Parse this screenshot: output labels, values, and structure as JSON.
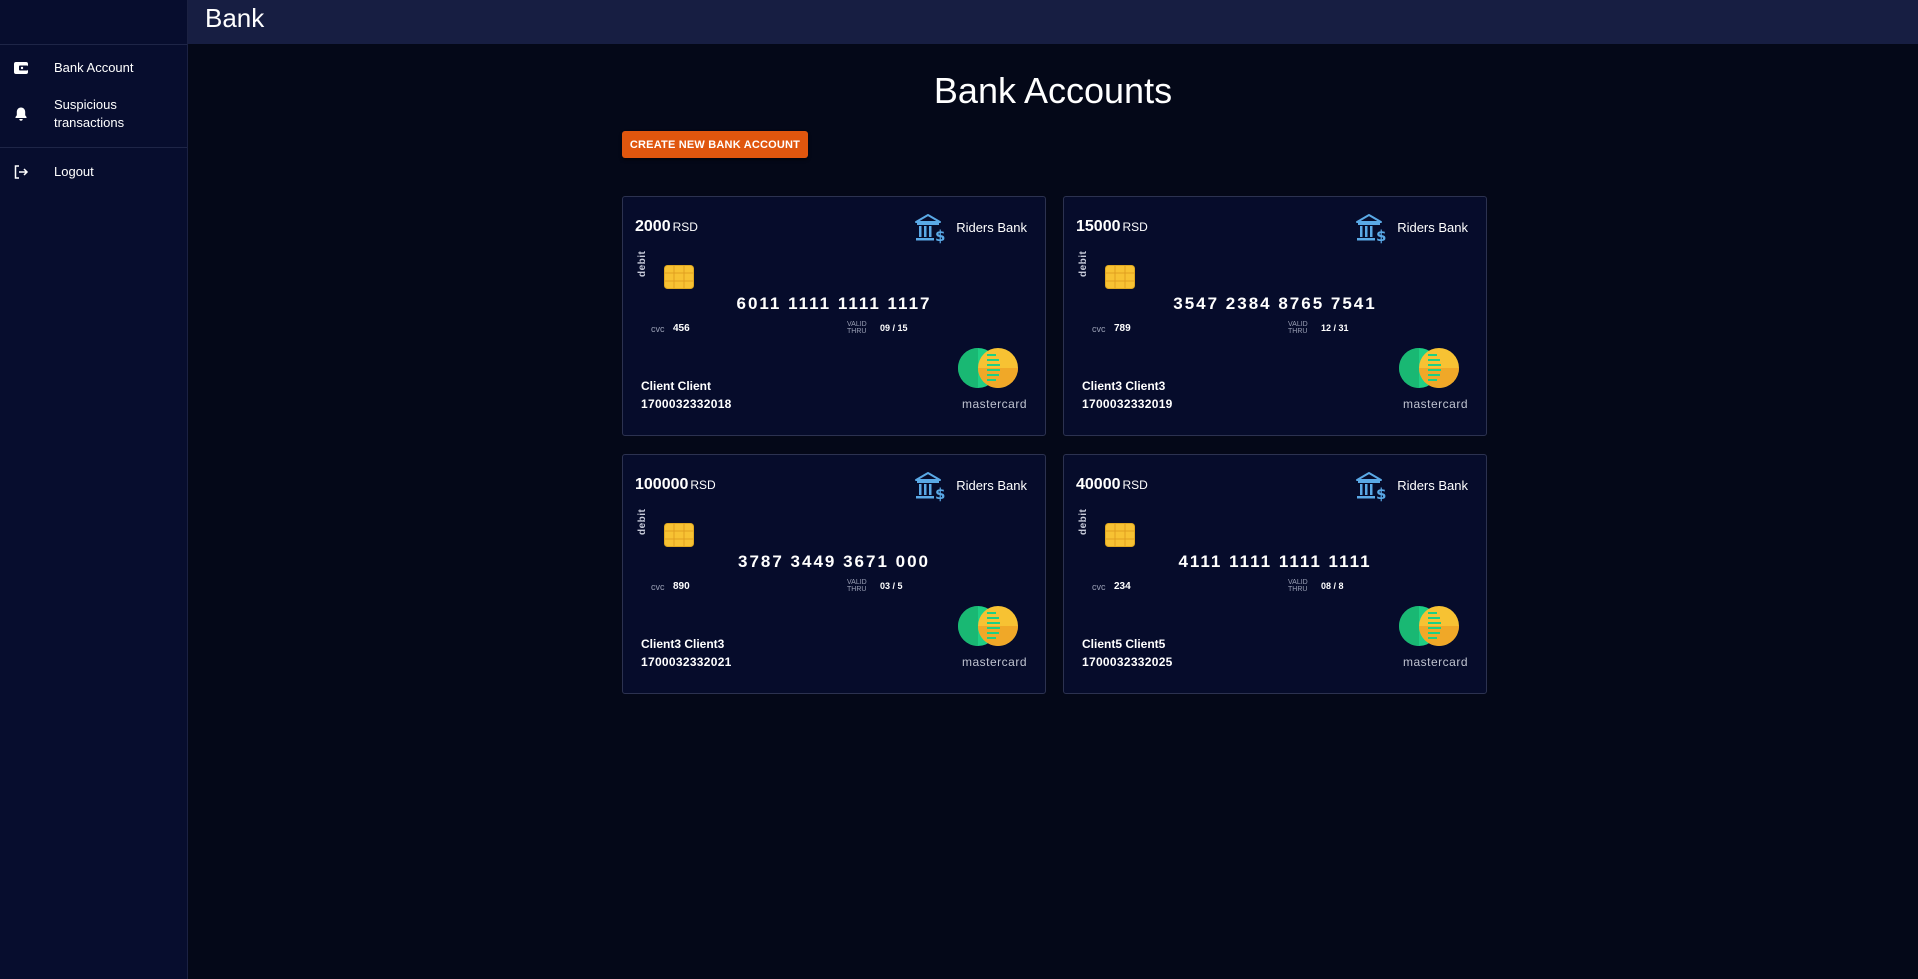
{
  "app": {
    "title": "Bank"
  },
  "sidebar": {
    "items": [
      {
        "label": "Bank Account",
        "icon": "wallet-icon"
      },
      {
        "label": "Suspicious\ntransactions",
        "icon": "bell-icon"
      },
      {
        "label": "Logout",
        "icon": "logout-icon"
      }
    ]
  },
  "main": {
    "title": "Bank Accounts",
    "create_button": "CREATE NEW BANK ACCOUNT"
  },
  "cards": [
    {
      "balance": "2000",
      "currency": "RSD",
      "bank": "Riders Bank",
      "type": "debit",
      "number": "6011 1111 1111 1117",
      "cvc_label": "cvc",
      "cvc": "456",
      "valid_label": "VALID THRU",
      "valid": "09 / 15",
      "holder": "Client Client",
      "account": "1700032332018",
      "brand": "mastercard"
    },
    {
      "balance": "15000",
      "currency": "RSD",
      "bank": "Riders Bank",
      "type": "debit",
      "number": "3547 2384 8765 7541",
      "cvc_label": "cvc",
      "cvc": "789",
      "valid_label": "VALID THRU",
      "valid": "12 / 31",
      "holder": "Client3 Client3",
      "account": "1700032332019",
      "brand": "mastercard"
    },
    {
      "balance": "100000",
      "currency": "RSD",
      "bank": "Riders Bank",
      "type": "debit",
      "number": "3787 3449 3671 000",
      "cvc_label": "cvc",
      "cvc": "890",
      "valid_label": "VALID THRU",
      "valid": "03 / 5",
      "holder": "Client3 Client3",
      "account": "1700032332021",
      "brand": "mastercard"
    },
    {
      "balance": "40000",
      "currency": "RSD",
      "bank": "Riders Bank",
      "type": "debit",
      "number": "4111 1111 1111 1111",
      "cvc_label": "cvc",
      "cvc": "234",
      "valid_label": "VALID THRU",
      "valid": "08 / 8",
      "holder": "Client5 Client5",
      "account": "1700032332025",
      "brand": "mastercard"
    }
  ],
  "colors": {
    "background": "#040818",
    "sidebar": "#070d2e",
    "topbar": "#171e42",
    "card": "#060c2b",
    "accent_button": "#e0560e",
    "mc_green": "#1fcf84",
    "mc_yellow": "#f7c233",
    "bank_icon": "#5aa9e6"
  }
}
